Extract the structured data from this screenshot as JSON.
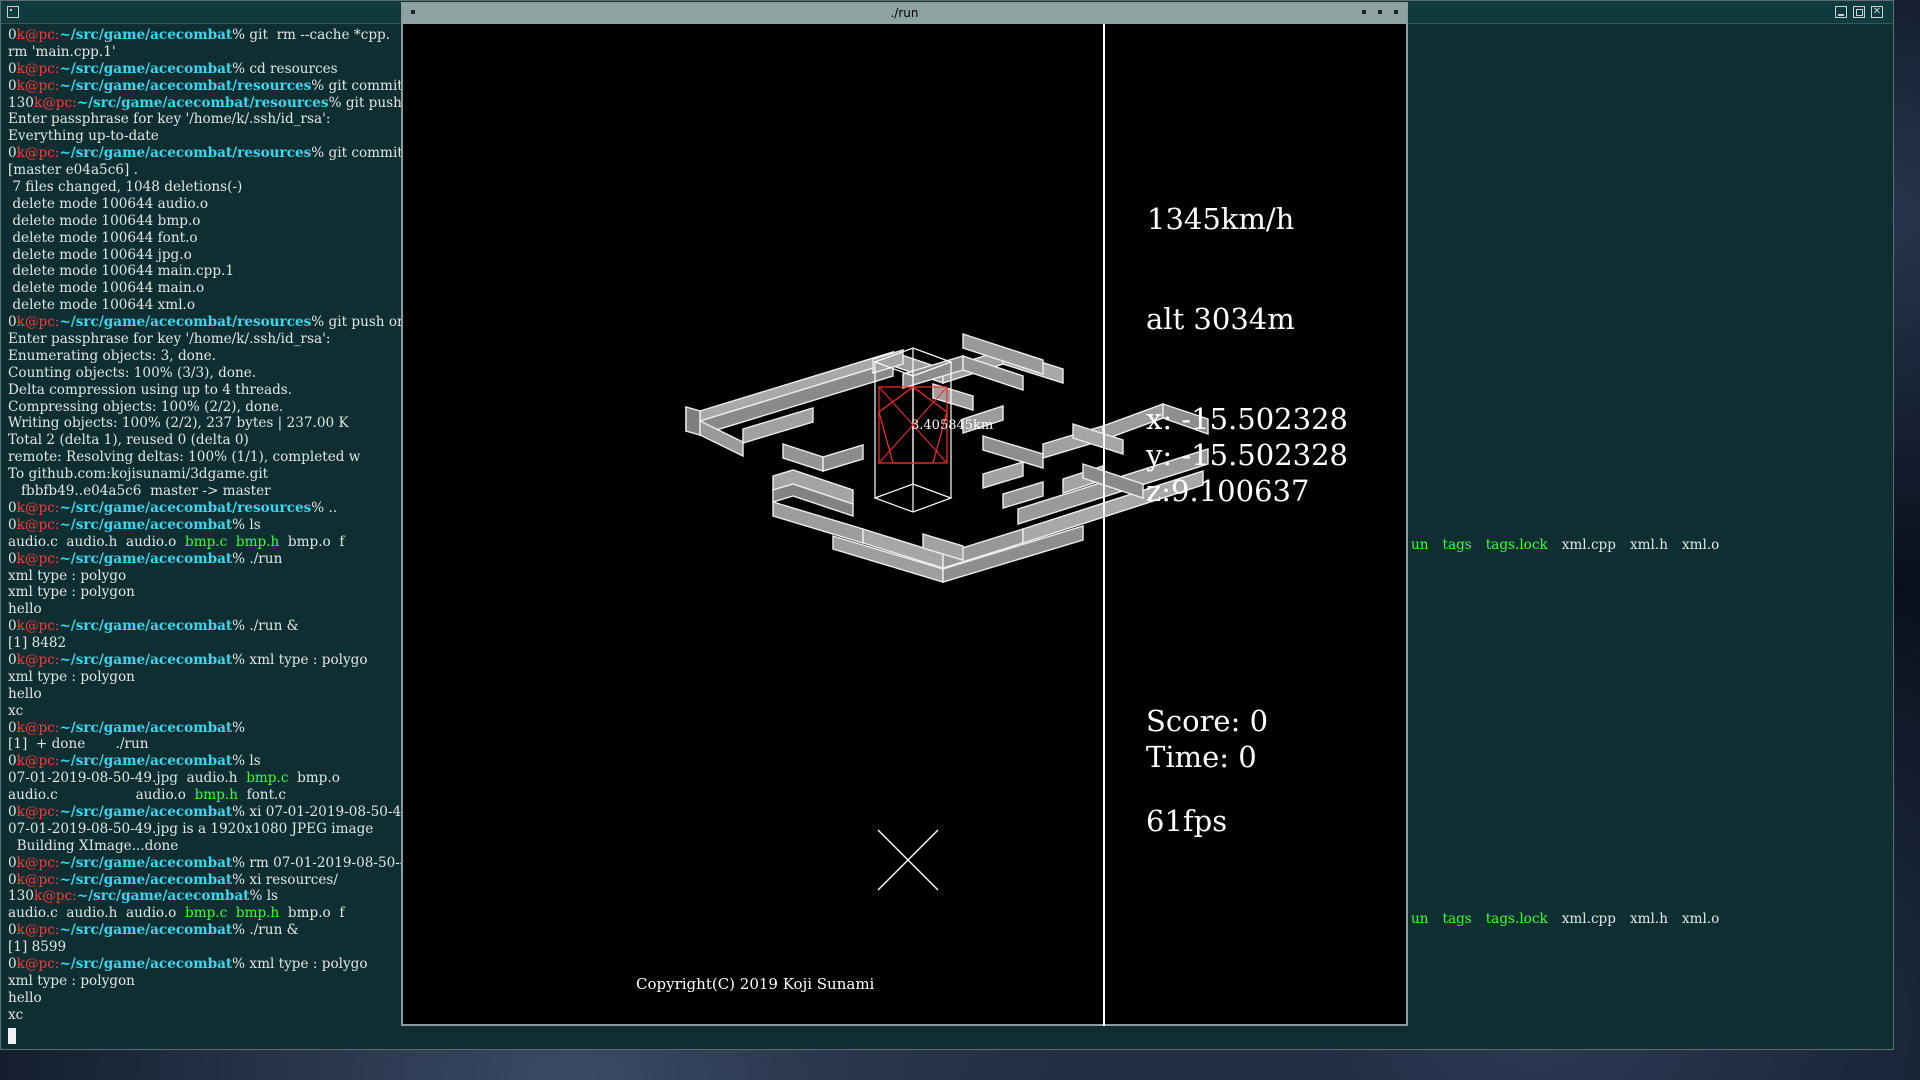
{
  "terminal": {
    "lines": [
      [
        [
          "st",
          "0"
        ],
        [
          "us",
          "k@pc:"
        ],
        [
          "pa",
          "~/src/game/acecombat"
        ],
        [
          "st",
          "% git  rm --cache *cpp."
        ]
      ],
      [
        [
          "st",
          "rm 'main.cpp.1'"
        ]
      ],
      [
        [
          "st",
          "0"
        ],
        [
          "us",
          "k@pc:"
        ],
        [
          "pa",
          "~/src/game/acecombat"
        ],
        [
          "st",
          "% cd resources"
        ]
      ],
      [
        [
          "st",
          "0"
        ],
        [
          "us",
          "k@pc:"
        ],
        [
          "pa",
          "~/src/game/acecombat/resources"
        ],
        [
          "st",
          "% git commit"
        ]
      ],
      [
        [
          "st",
          "130"
        ],
        [
          "us",
          "k@pc:"
        ],
        [
          "pa",
          "~/src/game/acecombat/resources"
        ],
        [
          "st",
          "% git push"
        ]
      ],
      [
        [
          "st",
          "Enter passphrase for key '/home/k/.ssh/id_rsa':"
        ]
      ],
      [
        [
          "st",
          "Everything up-to-date"
        ]
      ],
      [
        [
          "st",
          "0"
        ],
        [
          "us",
          "k@pc:"
        ],
        [
          "pa",
          "~/src/game/acecombat/resources"
        ],
        [
          "st",
          "% git commit"
        ]
      ],
      [
        [
          "st",
          "[master e04a5c6] ."
        ]
      ],
      [
        [
          "st",
          " 7 files changed, 1048 deletions(-)"
        ]
      ],
      [
        [
          "st",
          " delete mode 100644 audio.o"
        ]
      ],
      [
        [
          "st",
          " delete mode 100644 bmp.o"
        ]
      ],
      [
        [
          "st",
          " delete mode 100644 font.o"
        ]
      ],
      [
        [
          "st",
          " delete mode 100644 jpg.o"
        ]
      ],
      [
        [
          "st",
          " delete mode 100644 main.cpp.1"
        ]
      ],
      [
        [
          "st",
          " delete mode 100644 main.o"
        ]
      ],
      [
        [
          "st",
          " delete mode 100644 xml.o"
        ]
      ],
      [
        [
          "st",
          "0"
        ],
        [
          "us",
          "k@pc:"
        ],
        [
          "pa",
          "~/src/game/acecombat/resources"
        ],
        [
          "st",
          "% git push or"
        ]
      ],
      [
        [
          "st",
          "Enter passphrase for key '/home/k/.ssh/id_rsa':"
        ]
      ],
      [
        [
          "st",
          "Enumerating objects: 3, done."
        ]
      ],
      [
        [
          "st",
          "Counting objects: 100% (3/3), done."
        ]
      ],
      [
        [
          "st",
          "Delta compression using up to 4 threads."
        ]
      ],
      [
        [
          "st",
          "Compressing objects: 100% (2/2), done."
        ]
      ],
      [
        [
          "st",
          "Writing objects: 100% (2/2), 237 bytes | 237.00 K"
        ]
      ],
      [
        [
          "st",
          "Total 2 (delta 1), reused 0 (delta 0)"
        ]
      ],
      [
        [
          "st",
          "remote: Resolving deltas: 100% (1/1), completed w"
        ]
      ],
      [
        [
          "st",
          "To github.com:kojisunami/3dgame.git"
        ]
      ],
      [
        [
          "st",
          "   fbbfb49..e04a5c6  master -> master"
        ]
      ],
      [
        [
          "st",
          "0"
        ],
        [
          "us",
          "k@pc:"
        ],
        [
          "pa",
          "~/src/game/acecombat/resources"
        ],
        [
          "st",
          "% .."
        ]
      ],
      [
        [
          "st",
          "0"
        ],
        [
          "us",
          "k@pc:"
        ],
        [
          "pa",
          "~/src/game/acecombat"
        ],
        [
          "st",
          "% ls"
        ]
      ],
      [
        [
          "st",
          "audio.c  audio.h  audio.o  "
        ],
        [
          "ex",
          "bmp.c"
        ],
        [
          "st",
          "  "
        ],
        [
          "ex",
          "bmp.h"
        ],
        [
          "st",
          "  bmp.o  f"
        ]
      ],
      [
        [
          "st",
          "0"
        ],
        [
          "us",
          "k@pc:"
        ],
        [
          "pa",
          "~/src/game/acecombat"
        ],
        [
          "st",
          "% ./run"
        ]
      ],
      [
        [
          "st",
          "xml type : polygo"
        ]
      ],
      [
        [
          "st",
          "xml type : polygon"
        ]
      ],
      [
        [
          "st",
          "hello"
        ]
      ],
      [
        [
          "st",
          "0"
        ],
        [
          "us",
          "k@pc:"
        ],
        [
          "pa",
          "~/src/game/acecombat"
        ],
        [
          "st",
          "% ./run &"
        ]
      ],
      [
        [
          "st",
          "[1] 8482"
        ]
      ],
      [
        [
          "st",
          "0"
        ],
        [
          "us",
          "k@pc:"
        ],
        [
          "pa",
          "~/src/game/acecombat"
        ],
        [
          "st",
          "% xml type : polygo"
        ]
      ],
      [
        [
          "st",
          "xml type : polygon"
        ]
      ],
      [
        [
          "st",
          "hello"
        ]
      ],
      [
        [
          "st",
          "xc"
        ]
      ],
      [
        [
          "st",
          "0"
        ],
        [
          "us",
          "k@pc:"
        ],
        [
          "pa",
          "~/src/game/acecombat"
        ],
        [
          "st",
          "%"
        ]
      ],
      [
        [
          "st",
          "[1]  + done       ./run"
        ]
      ],
      [
        [
          "st",
          "0"
        ],
        [
          "us",
          "k@pc:"
        ],
        [
          "pa",
          "~/src/game/acecombat"
        ],
        [
          "st",
          "% ls"
        ]
      ],
      [
        [
          "st",
          "07-01-2019-08-50-49.jpg  audio.h  "
        ],
        [
          "ex",
          "bmp.c"
        ],
        [
          "st",
          "  bmp.o"
        ]
      ],
      [
        [
          "st",
          "audio.c                  audio.o  "
        ],
        [
          "ex",
          "bmp.h"
        ],
        [
          "st",
          "  font.c"
        ]
      ],
      [
        [
          "st",
          "0"
        ],
        [
          "us",
          "k@pc:"
        ],
        [
          "pa",
          "~/src/game/acecombat"
        ],
        [
          "st",
          "% xi 07-01-2019-08-50-4"
        ]
      ],
      [
        [
          "st",
          "07-01-2019-08-50-49.jpg is a 1920x1080 JPEG image"
        ]
      ],
      [
        [
          "st",
          "  Building XImage...done"
        ]
      ],
      [
        [
          "st",
          "0"
        ],
        [
          "us",
          "k@pc:"
        ],
        [
          "pa",
          "~/src/game/acecombat"
        ],
        [
          "st",
          "% rm 07-01-2019-08-50-4"
        ]
      ],
      [
        [
          "st",
          "0"
        ],
        [
          "us",
          "k@pc:"
        ],
        [
          "pa",
          "~/src/game/acecombat"
        ],
        [
          "st",
          "% xi resources/"
        ]
      ],
      [
        [
          "st",
          "130"
        ],
        [
          "us",
          "k@pc:"
        ],
        [
          "pa",
          "~/src/game/acecombat"
        ],
        [
          "st",
          "% ls"
        ]
      ],
      [
        [
          "st",
          "audio.c  audio.h  audio.o  "
        ],
        [
          "ex",
          "bmp.c"
        ],
        [
          "st",
          "  "
        ],
        [
          "ex",
          "bmp.h"
        ],
        [
          "st",
          "  bmp.o  f"
        ]
      ],
      [
        [
          "st",
          "0"
        ],
        [
          "us",
          "k@pc:"
        ],
        [
          "pa",
          "~/src/game/acecombat"
        ],
        [
          "st",
          "% ./run &"
        ]
      ],
      [
        [
          "st",
          "[1] 8599"
        ]
      ],
      [
        [
          "st",
          "0"
        ],
        [
          "us",
          "k@pc:"
        ],
        [
          "pa",
          "~/src/game/acecombat"
        ],
        [
          "st",
          "% xml type : polygo"
        ]
      ],
      [
        [
          "st",
          "xml type : polygon"
        ]
      ],
      [
        [
          "st",
          "hello"
        ]
      ],
      [
        [
          "st",
          "xc"
        ]
      ]
    ],
    "ls_fragment": [
      [
        "ex",
        "un"
      ],
      [
        "ex",
        "tags"
      ],
      [
        "ex",
        "tags.lock"
      ],
      [
        "st",
        "xml.cpp"
      ],
      [
        "st",
        "xml.h"
      ],
      [
        "st",
        "xml.o"
      ]
    ]
  },
  "run_window": {
    "title": "./run",
    "hud": {
      "speed": "1345km/h",
      "alt": "alt 3034m",
      "x": "x: -15.502328",
      "y": "y: -15.502328",
      "z": "z:9.100637",
      "score": "Score: 0",
      "time": "Time: 0",
      "fps": "61fps",
      "target_distance": "3.405845km"
    },
    "copyright": "Copyright(C) 2019 Koji Sunami"
  },
  "colors": {
    "terminal_bg": "#0e2e31",
    "user_host": "#ff3a3a",
    "path": "#38d8f0",
    "executable": "#3cff3c",
    "run_titlebar": "#8fa3a3"
  }
}
